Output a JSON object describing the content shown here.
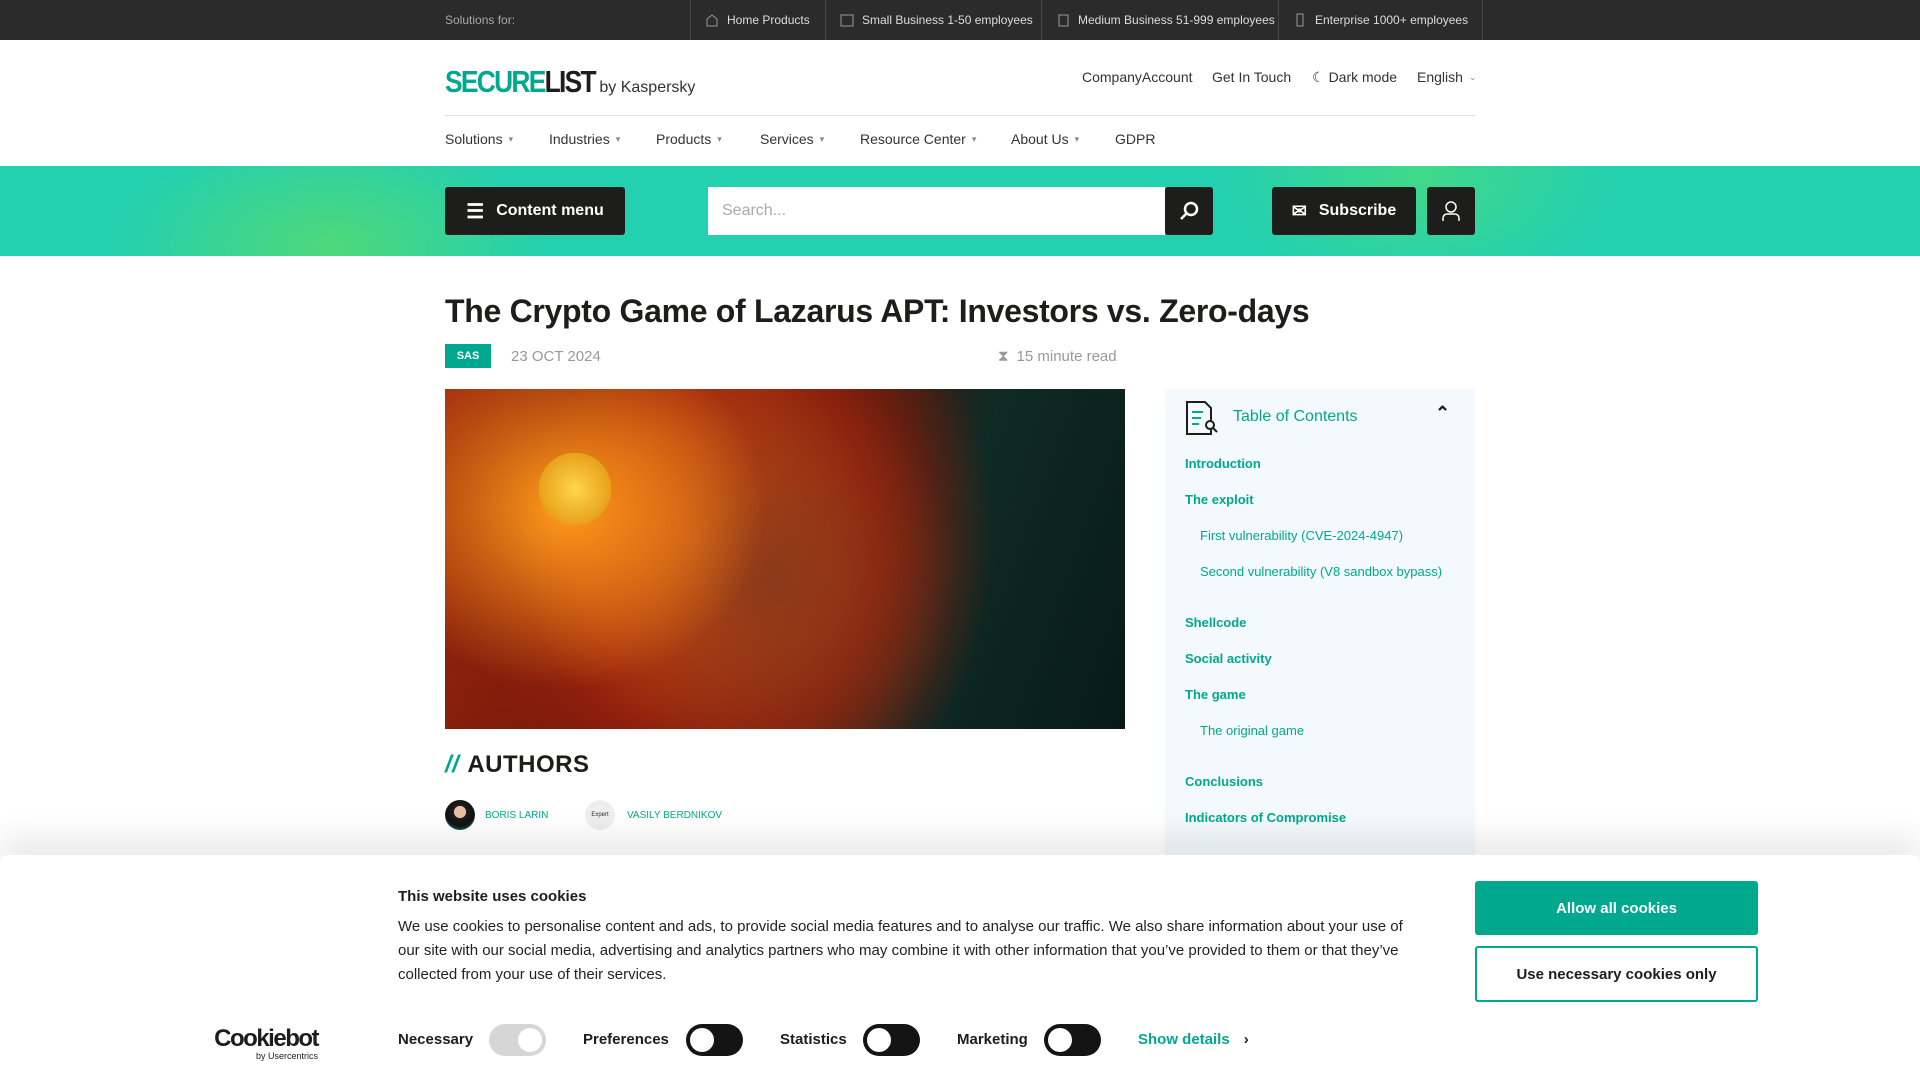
{
  "topbar": {
    "label": "Solutions for:",
    "items": [
      "Home Products",
      "Small Business 1-50 employees",
      "Medium Business 51-999 employees",
      "Enterprise 1000+ employees"
    ]
  },
  "header": {
    "logo_a": "SECURE",
    "logo_b": "LIST",
    "logo_by": "by Kaspersky",
    "links": [
      "CompanyAccount",
      "Get In Touch",
      "Dark mode",
      "English"
    ]
  },
  "nav": [
    "Solutions",
    "Industries",
    "Products",
    "Services",
    "Resource Center",
    "About Us",
    "GDPR"
  ],
  "toolbar": {
    "content_menu": "Content menu",
    "search_placeholder": "Search...",
    "subscribe": "Subscribe"
  },
  "article": {
    "title": "The Crypto Game of Lazarus APT: Investors vs. Zero-days",
    "tag": "SAS",
    "date": "23 OCT 2024",
    "read_time": "15 minute read",
    "authors_heading": "AUTHORS",
    "authors": [
      {
        "name": "BORIS LARIN"
      },
      {
        "name": "VASILY BERDNIKOV",
        "avatar_text": "Expert"
      }
    ]
  },
  "toc": {
    "title": "Table of Contents",
    "items": [
      {
        "label": "Introduction",
        "level": 1
      },
      {
        "label": "The exploit",
        "level": 1
      },
      {
        "label": "First vulnerability (CVE-2024-4947)",
        "level": 2
      },
      {
        "label": "Second vulnerability (V8 sandbox bypass)",
        "level": 2
      },
      {
        "label": "Shellcode",
        "level": 1
      },
      {
        "label": "Social activity",
        "level": 1
      },
      {
        "label": "The game",
        "level": 1
      },
      {
        "label": "The original game",
        "level": 2
      },
      {
        "label": "Conclusions",
        "level": 1
      },
      {
        "label": "Indicators of Compromise",
        "level": 1
      }
    ]
  },
  "cookie": {
    "title": "This website uses cookies",
    "text": "We use cookies to personalise content and ads, to provide social media features and to analyse our traffic. We also share information about your use of our site with our social media, advertising and analytics partners who may combine it with other information that you’ve provided to them or that they’ve collected from your use of their services.",
    "allow_all": "Allow all cookies",
    "necessary_only": "Use necessary cookies only",
    "brand": "Cookiebot",
    "brand_sub": "by Usercentrics",
    "toggles": [
      {
        "label": "Necessary",
        "on": true,
        "disabled": true
      },
      {
        "label": "Preferences",
        "on": false
      },
      {
        "label": "Statistics",
        "on": false
      },
      {
        "label": "Marketing",
        "on": false
      }
    ],
    "show_details": "Show details"
  },
  "colors": {
    "accent": "#00a88e",
    "band": "#23d0b0",
    "dark": "#1d1d1b"
  }
}
